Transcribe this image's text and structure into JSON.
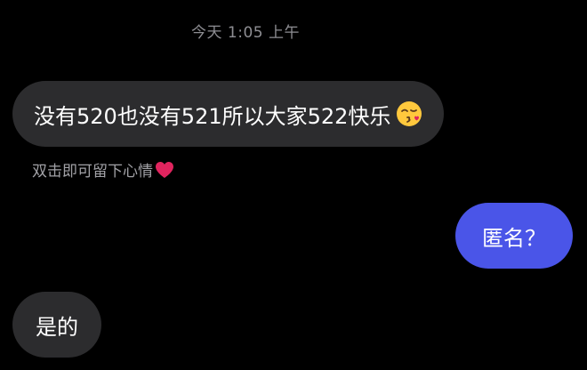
{
  "conversation": {
    "timestamp": "今天 1:05 上午",
    "messages": [
      {
        "direction": "incoming",
        "text": "没有520也没有521所以大家522快乐",
        "emoji": "kissing-heart-emoji"
      },
      {
        "direction": "outgoing",
        "text": "匿名？"
      },
      {
        "direction": "incoming",
        "text": "是的"
      }
    ],
    "hint": "双击即可留下心情",
    "hint_icon": "red-heart-icon"
  },
  "colors": {
    "background": "#000000",
    "incoming_bubble": "#2c2c2e",
    "outgoing_bubble": "#4a55e8",
    "meta_text": "#8e8e93",
    "heart": "#e0245e"
  }
}
